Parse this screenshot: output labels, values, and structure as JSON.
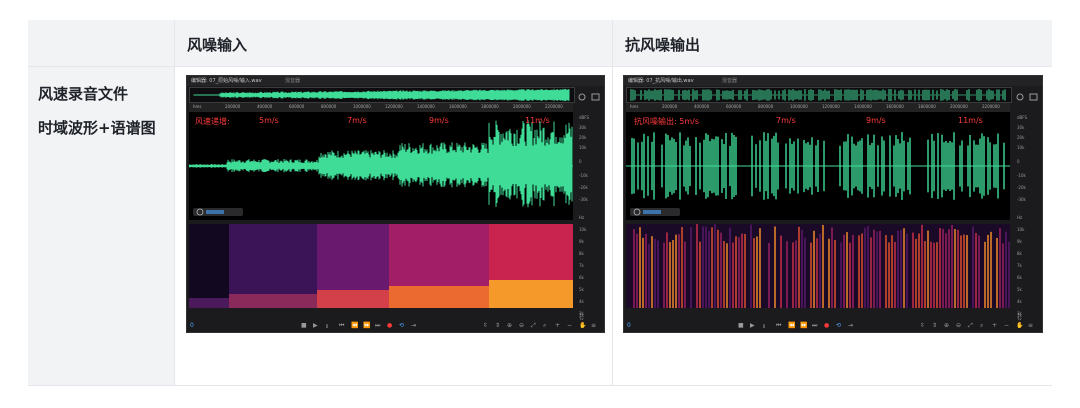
{
  "header": {
    "col1": "",
    "col2": "风噪输入",
    "col3": "抗风噪输出"
  },
  "row": {
    "label1": "风速录音文件",
    "label2": "时域波形+语谱图"
  },
  "left_shot": {
    "tab": "编辑器: 07_原始风噪/输入.wav",
    "tab2": "混音器",
    "wave_labels": [
      "风速递增:",
      "5m/s",
      "7m/s",
      "9m/s",
      "11m/s"
    ],
    "ruler": [
      "hms",
      "200000",
      "400000",
      "600000",
      "800000",
      "1000000",
      "1200000",
      "1400000",
      "1600000",
      "1800000",
      "2000000",
      "2200000"
    ],
    "scale": [
      "dBFS",
      "30k",
      "20k",
      "10k",
      "0",
      "-10k",
      "-20k",
      "-30k",
      "Hz",
      "10k",
      "9k",
      "8k",
      "7k",
      "6k",
      "5k",
      "4k",
      "3k",
      "2k",
      "1k"
    ],
    "time": "0",
    "wave_color": "#3fdc98"
  },
  "right_shot": {
    "tab": "编辑器: 07_抗风噪/输出.wav",
    "tab2": "混音器",
    "wave_labels": [
      "抗风噪输出: 5m/s",
      "7m/s",
      "9m/s",
      "11m/s"
    ],
    "ruler": [
      "hms",
      "200000",
      "400000",
      "600000",
      "800000",
      "1000000",
      "1200000",
      "1400000",
      "1600000",
      "1800000",
      "2000000",
      "2200000"
    ],
    "scale": [
      "dBFS",
      "30k",
      "20k",
      "10k",
      "0",
      "-10k",
      "-20k",
      "-30k",
      "Hz",
      "10k",
      "9k",
      "8k",
      "7k",
      "6k",
      "5k",
      "4k",
      "3k",
      "2k",
      "1k"
    ],
    "time": "0",
    "wave_color": "#3fdc98"
  },
  "colors": {
    "header_bg": "#f2f3f5",
    "accent_blue": "#4da3ff",
    "label_red": "#ff3b3b"
  }
}
